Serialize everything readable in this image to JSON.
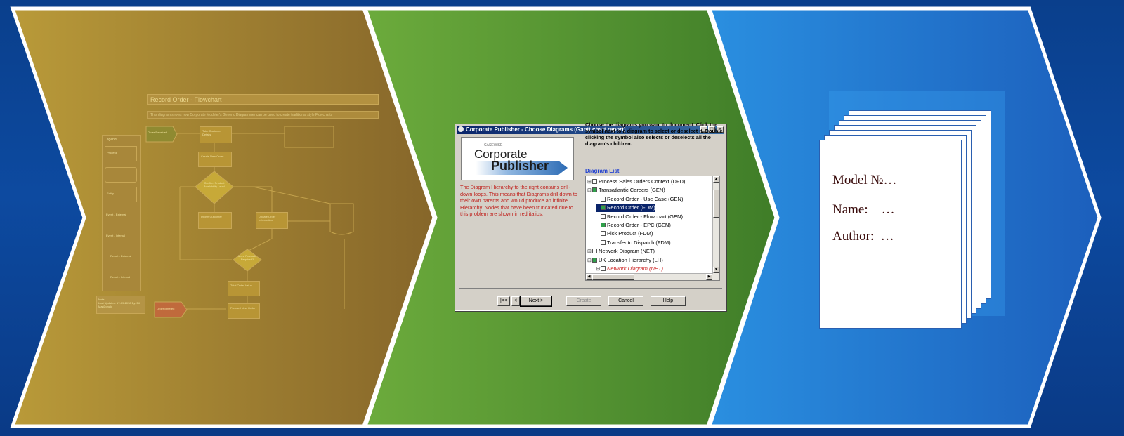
{
  "stages": [
    {
      "id": "flowchart",
      "fill_from": "#b99a39",
      "fill_to": "#86662a"
    },
    {
      "id": "publisher",
      "fill_from": "#6cab3c",
      "fill_to": "#3f7d28"
    },
    {
      "id": "document",
      "fill_from": "#2a8fe0",
      "fill_to": "#1c5fbc"
    }
  ],
  "flowchart": {
    "title": "Record Order - Flowchart",
    "subtitle": "This diagram shows how Corporate Modeler's Generic Diagrammer can be used to create traditional style Flowcharts",
    "legend_title": "Legend",
    "legend_items": [
      "Process",
      "",
      "Entity",
      "Event - External",
      "Event - Internal",
      "Result - External",
      "Result - Internal"
    ],
    "note_title": "Note",
    "note_text": "Last Updated: 17-09-2018 By: Bill MacDonald",
    "nodes": [
      "Order Received",
      "Take Customer Details",
      "Create New Order",
      "Confirm Product Availability Level",
      "Inform Customer",
      "Update Order Information",
      "More Products Required?",
      "Total Order Value",
      "Forward New Order",
      "Order Entered"
    ]
  },
  "dialog": {
    "title": "Corporate Publisher - Choose Diagrams (Gantt chart report)",
    "logo_small": "CASEWISE",
    "logo_line1": "Corporate",
    "logo_line2": "Publisher",
    "instructions": "Choose the diagrams you want to document. Click the symbol next to a diagram to select or deselect it. Double clicking the symbol also selects or deselects all the diagram's children.",
    "description": "The Diagram Hierarchy to the right contains drill-down loops. This means that Diagrams drill down to their own parents and would produce an infinite Hierarchy. Nodes that have been truncated due to this problem are shown in red italics.",
    "list_label": "Diagram List",
    "tree": [
      {
        "label": "Process Sales Orders Context (DFD)",
        "expander": "⊞",
        "checked": false,
        "indent": 0,
        "selected": false,
        "red": false
      },
      {
        "label": "Transatlantic Careers (GEN)",
        "expander": "⊟",
        "checked": true,
        "indent": 0,
        "selected": false,
        "red": false
      },
      {
        "label": "Record Order - Use Case (GEN)",
        "expander": "",
        "checked": false,
        "indent": 1,
        "selected": false,
        "red": false
      },
      {
        "label": "Record Order (FDM)",
        "expander": "",
        "checked": true,
        "indent": 1,
        "selected": true,
        "red": false
      },
      {
        "label": "Record Order - Flowchart (GEN)",
        "expander": "",
        "checked": false,
        "indent": 1,
        "selected": false,
        "red": false
      },
      {
        "label": "Record Order - EPC (GEN)",
        "expander": "",
        "checked": true,
        "indent": 1,
        "selected": false,
        "red": false
      },
      {
        "label": "Pick Product (FDM)",
        "expander": "",
        "checked": false,
        "indent": 1,
        "selected": false,
        "red": false
      },
      {
        "label": "Transfer to Dispatch (FDM)",
        "expander": "",
        "checked": false,
        "indent": 1,
        "selected": false,
        "red": false
      },
      {
        "label": "Network Diagram (NET)",
        "expander": "⊞",
        "checked": false,
        "indent": 0,
        "selected": false,
        "red": false
      },
      {
        "label": "UK Location Hierarchy (LH)",
        "expander": "⊟",
        "checked": true,
        "indent": 0,
        "selected": false,
        "red": false
      },
      {
        "label": "Network Diagram (NET)",
        "expander": "⊟",
        "checked": false,
        "indent": 1,
        "selected": false,
        "red": true
      }
    ],
    "buttons": {
      "first": "|<<",
      "back": "<",
      "next": "Next >",
      "create": "Create",
      "cancel": "Cancel",
      "help": "Help"
    },
    "window_buttons": {
      "minimize": "_",
      "maximize": "□",
      "close": "×"
    }
  },
  "document": {
    "pages_behind": 6,
    "fields": [
      {
        "label": "Model №",
        "value": "…"
      },
      {
        "label": "Name:",
        "value": "…"
      },
      {
        "label": "Author:",
        "value": "…"
      }
    ]
  }
}
